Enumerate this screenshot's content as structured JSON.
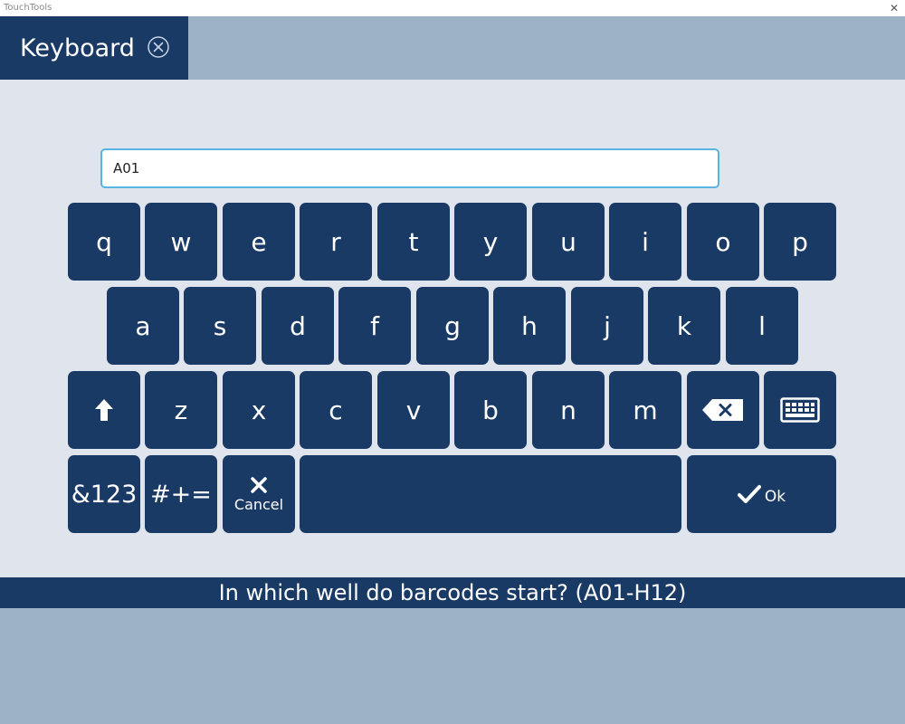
{
  "window": {
    "app_title": "TouchTools"
  },
  "tab": {
    "label": "Keyboard"
  },
  "input": {
    "value": "A01"
  },
  "keys": {
    "row1": [
      "q",
      "w",
      "e",
      "r",
      "t",
      "y",
      "u",
      "i",
      "o",
      "p"
    ],
    "row2": [
      "a",
      "s",
      "d",
      "f",
      "g",
      "h",
      "j",
      "k",
      "l"
    ],
    "row3": [
      "z",
      "x",
      "c",
      "v",
      "b",
      "n",
      "m"
    ],
    "numbers": "&123",
    "symbols": "#+=",
    "cancel": "Cancel",
    "ok": "Ok"
  },
  "icons": {
    "shift": "up-arrow-icon",
    "backspace": "backspace-icon",
    "keyboard": "keyboard-icon",
    "cancel": "x-icon",
    "ok": "checkmark-icon",
    "tab_close": "close-circle-icon"
  },
  "prompt": "In which well do barcodes start? (A01-H12)",
  "colors": {
    "key": "#1a3a66",
    "background": "#9db1c7",
    "panel": "#e0e4ec",
    "input_border": "#5ab4df"
  }
}
